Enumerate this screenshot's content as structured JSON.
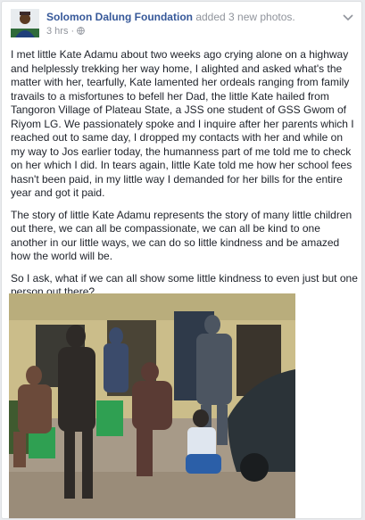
{
  "post": {
    "author": "Solomon Dalung Foundation",
    "action": "added 3 new photos.",
    "time": "3 hrs",
    "sep": "·",
    "privacy_icon": "globe-icon",
    "menu_icon": "chevron-down-icon",
    "paragraphs": [
      "I met little Kate Adamu about two weeks ago crying alone on a highway and helplessly trekking her way home, I alighted and asked what's the matter with her, tearfully, Kate lamented her ordeals ranging from family travails to a misfortunes to befell her Dad, the little Kate hailed from Tangoron Village of Plateau State, a JSS one student of GSS Gwom of Riyom LG. We passionately spoke and I inquire after her parents which I reached out to same day, I dropped my contacts with her and while on my way to Jos earlier today, the humanness part of me told me to check on her which I did. In tears again, little Kate told me how her school fees hasn't been paid, in my little way I demanded for her bills for the entire year and got it paid.",
      "The story of little Kate Adamu represents the story of many little children out there, we can all be compassionate, we can all be kind to one another in our little ways, we can do so little kindness and be amazed how the world will be.",
      "So I ask, what if we can all show some little kindness to even just but one person out there?"
    ]
  },
  "colors": {
    "link": "#365899",
    "meta": "#90949c",
    "text": "#1d2129",
    "page_bg": "#e9ebee"
  }
}
